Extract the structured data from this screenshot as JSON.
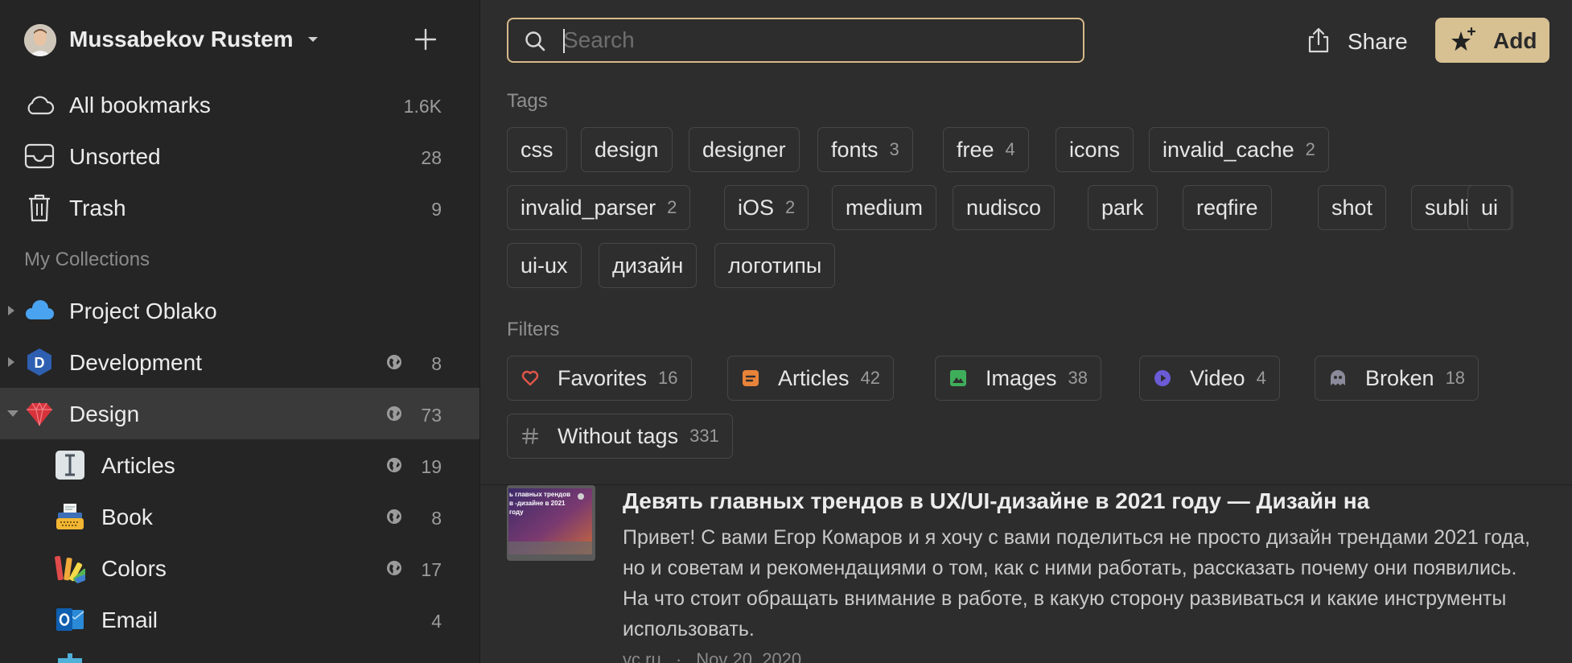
{
  "sidebar": {
    "user_name": "Mussabekov Rustem",
    "nav": [
      {
        "label": "All bookmarks",
        "count": "1.6K",
        "icon": "cloud-icon"
      },
      {
        "label": "Unsorted",
        "count": "28",
        "icon": "inbox-icon"
      },
      {
        "label": "Trash",
        "count": "9",
        "icon": "trash-icon"
      }
    ],
    "collections_title": "My Collections",
    "collections": [
      {
        "label": "Project Oblako",
        "count": "",
        "icon": "blue-cloud-icon",
        "expanded": false
      },
      {
        "label": "Development",
        "count": "8",
        "icon": "d-hexagon-icon",
        "expanded": false,
        "public": true
      },
      {
        "label": "Design",
        "count": "73",
        "icon": "red-gem-icon",
        "expanded": true,
        "public": true,
        "selected": true
      }
    ],
    "subcollections": [
      {
        "label": "Articles",
        "count": "19",
        "icon": "text-cursor-icon",
        "public": true
      },
      {
        "label": "Book",
        "count": "8",
        "icon": "typewriter-icon",
        "public": true
      },
      {
        "label": "Colors",
        "count": "17",
        "icon": "palette-icon",
        "public": true
      },
      {
        "label": "Email",
        "count": "4",
        "icon": "outlook-icon",
        "public": false
      }
    ]
  },
  "toolbar": {
    "search_placeholder": "Search",
    "share_label": "Share",
    "add_label": "Add"
  },
  "tags_title": "Tags",
  "tags": [
    {
      "name": "css",
      "count": ""
    },
    {
      "name": "design",
      "count": ""
    },
    {
      "name": "designer",
      "count": ""
    },
    {
      "name": "fonts",
      "count": "3"
    },
    {
      "name": "free",
      "count": "4"
    },
    {
      "name": "icons",
      "count": ""
    },
    {
      "name": "invalid_cache",
      "count": "2"
    },
    {
      "name": "invalid_parser",
      "count": "2"
    },
    {
      "name": "iOS",
      "count": "2"
    },
    {
      "name": "medium",
      "count": ""
    },
    {
      "name": "nudisco",
      "count": ""
    },
    {
      "name": "park",
      "count": ""
    },
    {
      "name": "reqfire",
      "count": ""
    },
    {
      "name": "shot",
      "count": ""
    },
    {
      "name": "sublime",
      "count": ""
    },
    {
      "name": "ui",
      "count": ""
    },
    {
      "name": "ui-ux",
      "count": ""
    },
    {
      "name": "дизайн",
      "count": ""
    },
    {
      "name": "логотипы",
      "count": ""
    }
  ],
  "filters_title": "Filters",
  "filters": [
    {
      "name": "Favorites",
      "count": "16",
      "icon": "heart-icon",
      "color": "#e0564a"
    },
    {
      "name": "Articles",
      "count": "42",
      "icon": "article-icon",
      "color": "#e8833a"
    },
    {
      "name": "Images",
      "count": "38",
      "icon": "image-icon",
      "color": "#3fae5a"
    },
    {
      "name": "Video",
      "count": "4",
      "icon": "play-icon",
      "color": "#6b5bd6"
    },
    {
      "name": "Broken",
      "count": "18",
      "icon": "ghost-icon",
      "color": "#8a8a9a"
    },
    {
      "name": "Without tags",
      "count": "331",
      "icon": "hash-icon",
      "color": "#8a8a8a"
    }
  ],
  "bookmark": {
    "title": "Девять главных трендов в UX/UI-дизайне в 2021 году — Дизайн на",
    "excerpt": "Привет! С вами Егор Комаров и я хочу с вами поделиться не просто дизайн трендами 2021 года, но и советам и рекомендациями о том, как с ними работать, рассказать почему они появились. На что стоит обращать внимание в работе, в какую сторону развиваться и какие инструменты использовать.",
    "domain": "vc.ru",
    "date": "Nov 20, 2020",
    "thumb_text": "ь главных трендов в -дизайне в 2021 году"
  },
  "colors": {
    "accent": "#d7c092",
    "search_border": "#d7b98a",
    "sidebar_bg": "#252525",
    "main_bg": "#2d2d2d",
    "selected_bg": "#3a3a3a"
  }
}
